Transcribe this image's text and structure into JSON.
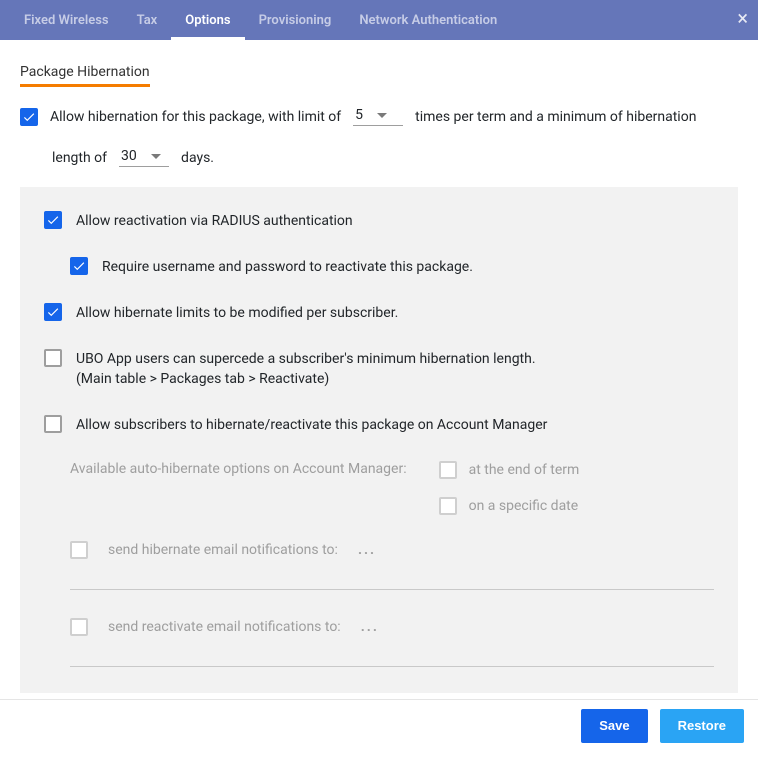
{
  "tabs": {
    "items": [
      "Fixed Wireless",
      "Tax",
      "Options",
      "Provisioning",
      "Network Authentication"
    ],
    "active_index": 2
  },
  "section_title": "Package Hibernation",
  "main_line": {
    "checked": true,
    "text_a": "Allow hibernation for this package, with limit of",
    "limit_value": "5",
    "text_b": "times per term and a minimum of hibernation",
    "text_c": "length of",
    "days_value": "30",
    "text_d": "days."
  },
  "options": {
    "radius": {
      "checked": true,
      "label": "Allow reactivation via RADIUS authentication"
    },
    "require": {
      "checked": true,
      "label": "Require username and password to reactivate this package."
    },
    "perSub": {
      "checked": true,
      "label": "Allow hibernate limits to be modified per subscriber."
    },
    "ubo": {
      "checked": false,
      "label": "UBO App users can supercede a subscriber's minimum hibernation length.",
      "sub": "(Main table > Packages tab > Reactivate)"
    },
    "acctMgr": {
      "checked": false,
      "label": "Allow subscribers to hibernate/reactivate this package on Account Manager"
    }
  },
  "auto_hib": {
    "prompt": "Available auto-hibernate options on Account Manager:",
    "end_term": {
      "checked": false,
      "label": "at the end of term"
    },
    "spec_date": {
      "checked": false,
      "label": "on a specific date"
    }
  },
  "send_hib": {
    "checked": false,
    "label": "send hibernate email notifications to:",
    "value": "..."
  },
  "send_react": {
    "checked": false,
    "label": "send reactivate email notifications to:",
    "value": "..."
  },
  "buttons": {
    "save": "Save",
    "restore": "Restore"
  }
}
